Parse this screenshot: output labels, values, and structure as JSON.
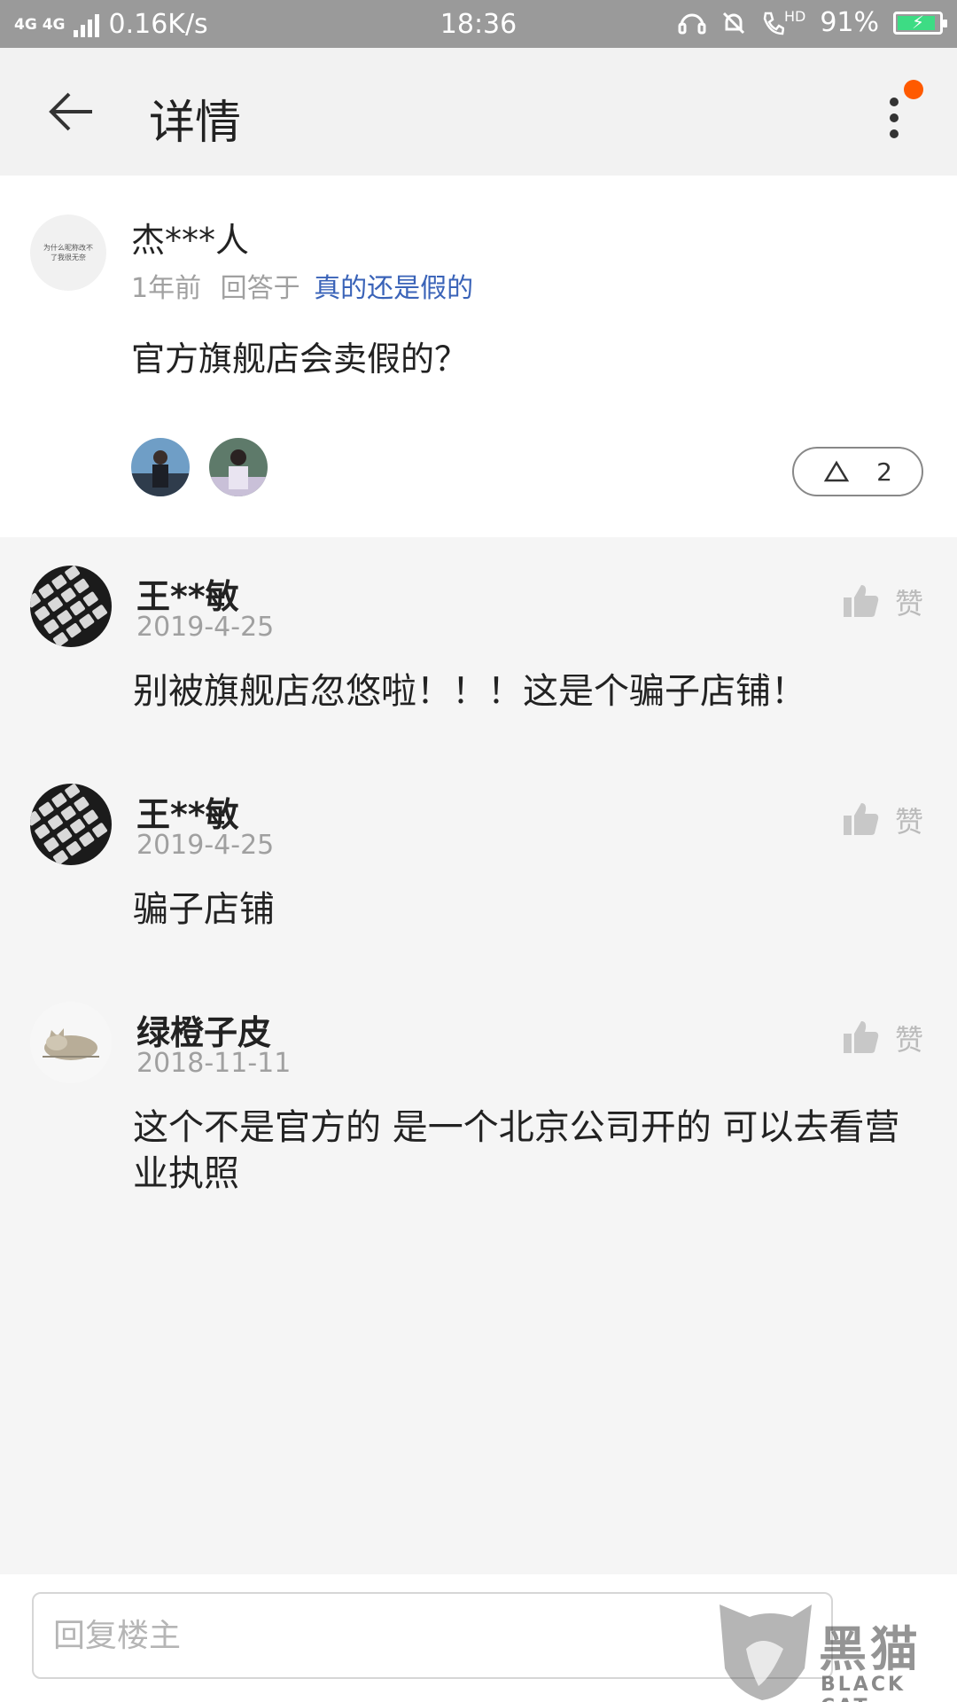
{
  "status_bar": {
    "network": "4G 4G",
    "speed": "0.16K/s",
    "time": "18:36",
    "hd": "HD",
    "battery": "91%",
    "battery_level": 0.91
  },
  "header": {
    "title": "详情"
  },
  "question": {
    "user_name": "杰***人",
    "avatar_text": "为什么昵称改不了我很无奈",
    "time_ago": "1年前",
    "answered_label": "回答于",
    "question_link": "真的还是假的",
    "text": "官方旗舰店会卖假的？",
    "vote_count": "2"
  },
  "answers": [
    {
      "user_name": "王**敏",
      "date": "2019-4-25",
      "like_label": "赞",
      "text": "别被旗舰店忽悠啦！！！这是个骗子店铺！"
    },
    {
      "user_name": "王**敏",
      "date": "2019-4-25",
      "like_label": "赞",
      "text": "骗子店铺"
    },
    {
      "user_name": "绿橙子皮",
      "date": "2018-11-11",
      "like_label": "赞",
      "text": "这个不是官方的 是一个北京公司开的 可以去看营业执照"
    }
  ],
  "reply": {
    "placeholder": "回复楼主"
  },
  "watermark": {
    "text": "黑猫",
    "sub": "BLACK CAT"
  },
  "colors": {
    "status_bar": "#9a9a9a",
    "link": "#3a63b8",
    "badge": "#ff5a00",
    "battery": "#3ddc84"
  }
}
